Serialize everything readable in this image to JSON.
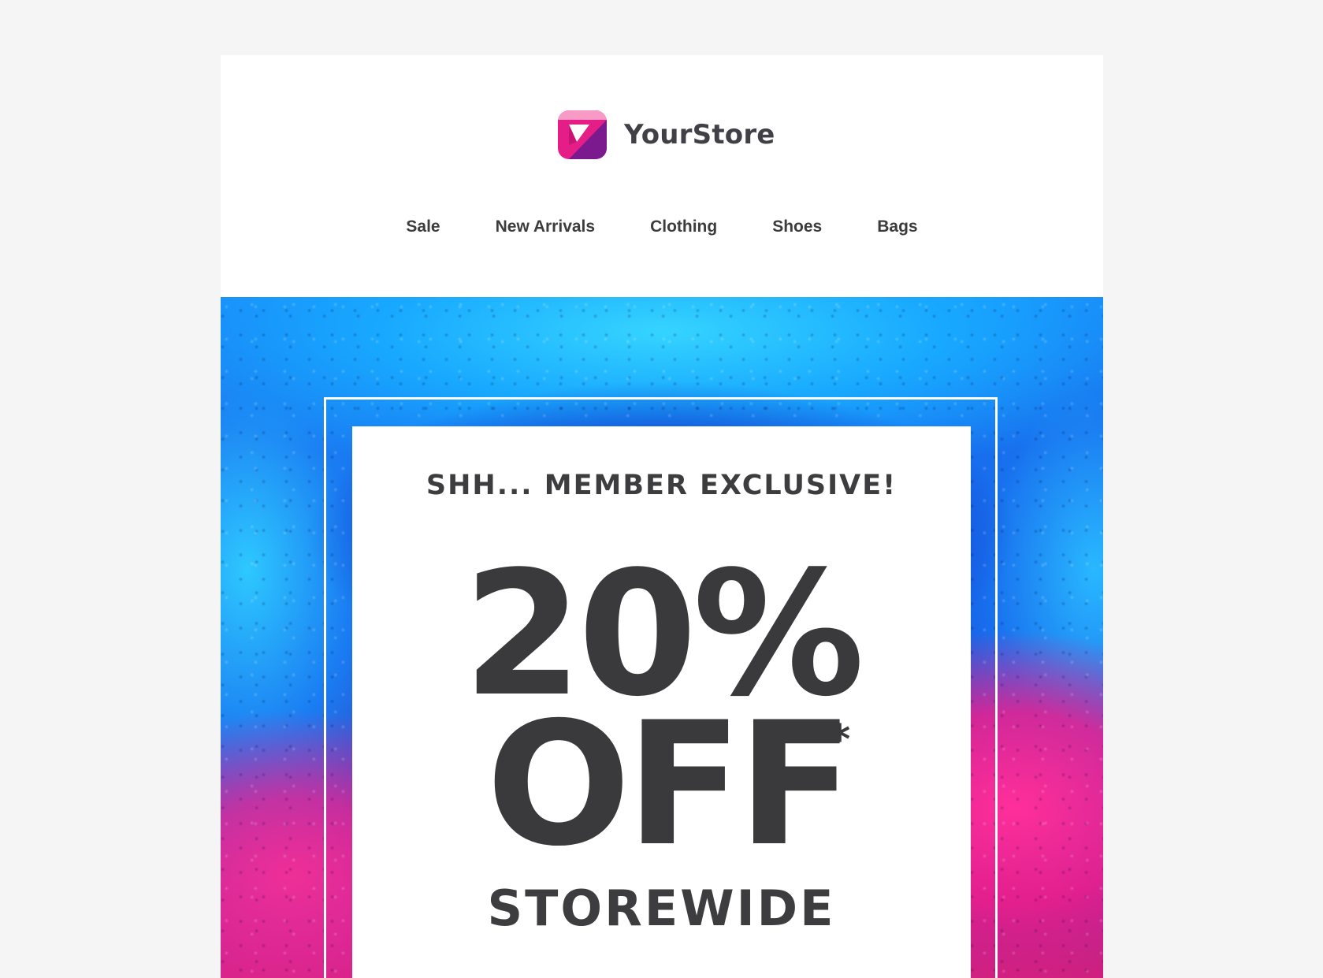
{
  "brand": {
    "name": "YourStore",
    "logo_icon": "store-logo-icon",
    "colors": {
      "logo_light": "#f79ac6",
      "logo_mid": "#e51d86",
      "logo_dark": "#7a1a8e",
      "text": "#3d3d3f",
      "background": "#f5f5f5"
    }
  },
  "nav": {
    "items": [
      {
        "label": "Sale"
      },
      {
        "label": "New Arrivals"
      },
      {
        "label": "Clothing"
      },
      {
        "label": "Shoes"
      },
      {
        "label": "Bags"
      }
    ]
  },
  "hero": {
    "eyebrow": "SHH... MEMBER EXCLUSIVE!",
    "discount": "20%",
    "off": "OFF",
    "asterisk": "*",
    "scope": "STOREWIDE"
  }
}
